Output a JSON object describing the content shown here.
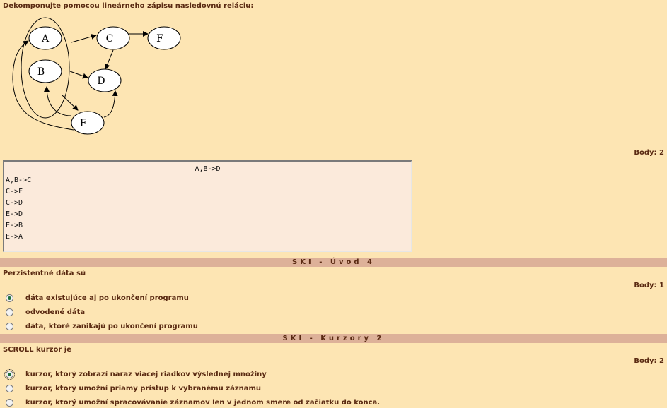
{
  "question1": {
    "prompt": "Dekomponujte pomocou lineárneho zápisu nasledovnú reláciu:",
    "graph_nodes": [
      "A",
      "B",
      "C",
      "D",
      "E",
      "F"
    ],
    "points": "Body: 2",
    "answer_lines": [
      "A,B->D",
      "A,B->C",
      "C->F",
      "C->D",
      "E->D",
      "E->B",
      "E->A"
    ]
  },
  "section2": {
    "title": "SKI - Úvod 4",
    "question": "Perzistentné dáta sú",
    "points": "Body: 1",
    "options": [
      "dáta existujúce aj po ukončení programu",
      "odvodené dáta",
      "dáta, ktoré zanikajú po ukončení programu"
    ],
    "selected_index": 0
  },
  "section3": {
    "title": "SKI - Kurzory 2",
    "question": "SCROLL kurzor je",
    "points": "Body: 2",
    "options": [
      "kurzor, ktorý zobrazí naraz viacej riadkov výslednej množiny",
      "kurzor, ktorý umožní priamy prístup k vybranému záznamu",
      "kurzor, ktorý umožní spracovávanie záznamov len v jednom smere od začiatku do konca."
    ],
    "selected_index": 0
  }
}
